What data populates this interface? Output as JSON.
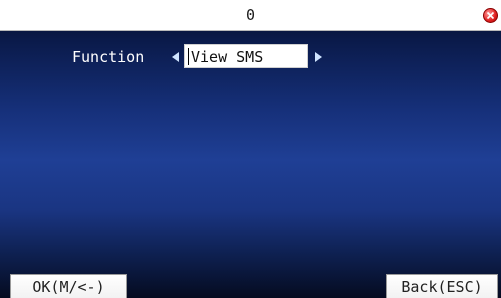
{
  "title": "0",
  "function_field": {
    "label": "Function",
    "value": "View SMS"
  },
  "softkeys": {
    "ok": "OK(M/<-)",
    "back": "Back(ESC)"
  },
  "icons": {
    "close": "close-icon",
    "prev": "arrow-left-icon",
    "next": "arrow-right-icon"
  },
  "colors": {
    "background_top": "#050a1e",
    "background_mid": "#1f3f95",
    "close_button": "#e02020",
    "arrow": "#cfe4ff"
  }
}
